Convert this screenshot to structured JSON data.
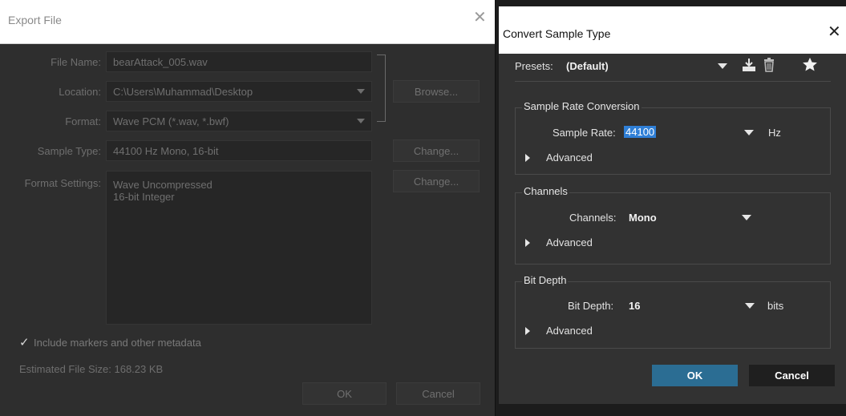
{
  "export_dialog": {
    "title": "Export File",
    "close_glyph": "✕",
    "file_name_label": "File Name:",
    "file_name_value": "bearAttack_005.wav",
    "location_label": "Location:",
    "location_value": "C:\\Users\\Muhammad\\Desktop",
    "browse_label": "Browse...",
    "format_label": "Format:",
    "format_value": "Wave PCM (*.wav, *.bwf)",
    "sample_type_label": "Sample Type:",
    "sample_type_value": "44100 Hz Mono, 16-bit",
    "sample_type_change_label": "Change...",
    "format_settings_label": "Format Settings:",
    "format_settings_lines": [
      "Wave Uncompressed",
      "16-bit Integer"
    ],
    "format_settings_change_label": "Change...",
    "include_markers_checked": true,
    "include_markers_check_glyph": "✓",
    "include_markers_label": "Include markers and other metadata",
    "estimated_size_text": "Estimated File Size: 168.23 KB",
    "ok_label": "OK",
    "cancel_label": "Cancel"
  },
  "convert_dialog": {
    "title": "Convert Sample Type",
    "close_glyph": "✕",
    "presets_label": "Presets:",
    "presets_value": "(Default)",
    "sample_rate_group_title": "Sample Rate Conversion",
    "sample_rate_label": "Sample Rate:",
    "sample_rate_value": "44100",
    "sample_rate_unit": "Hz",
    "sample_rate_advanced": "Advanced",
    "channels_group_title": "Channels",
    "channels_label": "Channels:",
    "channels_value": "Mono",
    "channels_advanced": "Advanced",
    "bit_depth_group_title": "Bit Depth",
    "bit_depth_label": "Bit Depth:",
    "bit_depth_value": "16",
    "bit_depth_unit": "bits",
    "bit_depth_advanced": "Advanced",
    "ok_label": "OK",
    "cancel_label": "Cancel"
  },
  "icons": {
    "import_preset": "download-tray-icon",
    "delete_preset": "trash-icon",
    "favorite_preset": "star-icon"
  },
  "colors": {
    "ok_accent": "#2b6d93",
    "selection_highlight": "#2f7fd6"
  }
}
